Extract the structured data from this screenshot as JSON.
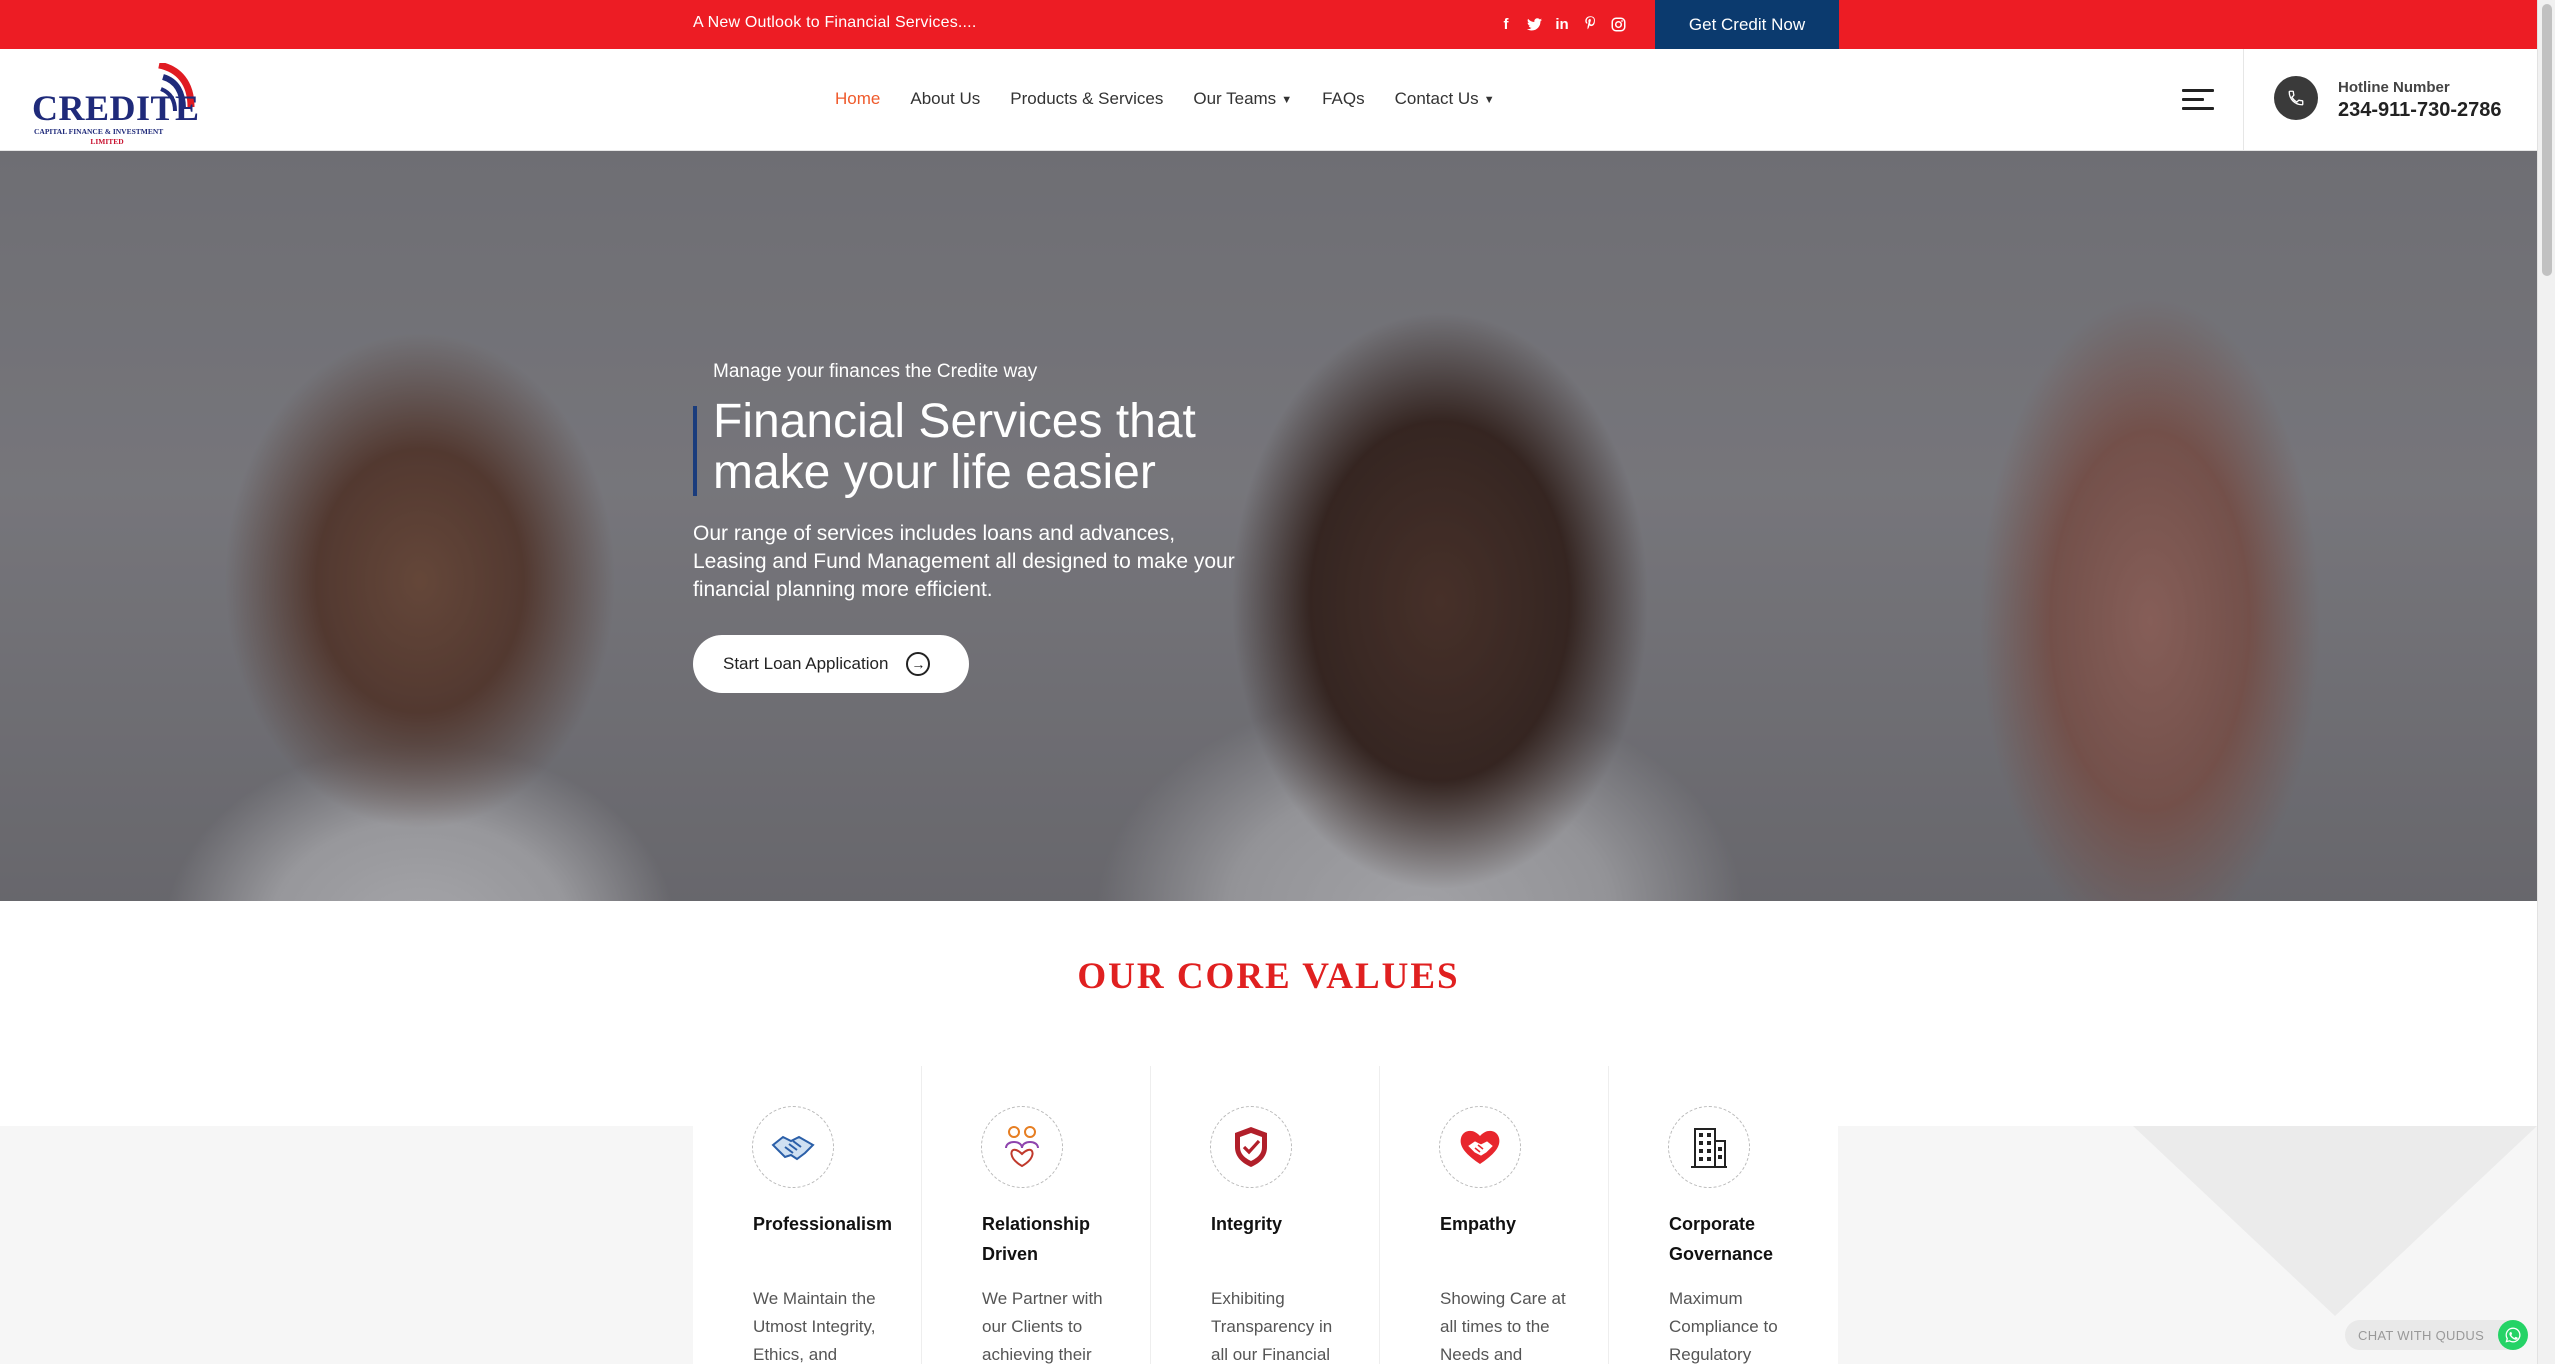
{
  "topbar": {
    "tagline": "A New Outlook to Financial Services....",
    "social_icons": [
      "facebook-icon",
      "twitter-icon",
      "linkedin-icon",
      "pinterest-icon",
      "instagram-icon"
    ],
    "cta_label": "Get Credit Now",
    "bg_color": "#ed1c24",
    "cta_color": "#0b3a6e"
  },
  "header": {
    "logo": {
      "name": "CREDITE",
      "subtitle": "CAPITAL FINANCE & INVESTMENT",
      "subtitle2": "LIMITED"
    },
    "nav": [
      {
        "label": "Home",
        "active": true
      },
      {
        "label": "About Us"
      },
      {
        "label": "Products & Services"
      },
      {
        "label": "Our Teams",
        "has_dropdown": true
      },
      {
        "label": "FAQs"
      },
      {
        "label": "Contact Us",
        "has_dropdown": true
      }
    ],
    "hotline_label": "Hotline Number",
    "hotline_number": "234-911-730-2786",
    "accent_color": "#ef5a2b"
  },
  "hero": {
    "kicker": "Manage your finances the Credite way",
    "title": "Financial Services that make your life easier",
    "description": "Our range of services includes loans and advances, Leasing and Fund Management all designed to make your financial planning more efficient.",
    "button_label": "Start Loan Application"
  },
  "core_values": {
    "title": "OUR CORE VALUES",
    "items": [
      {
        "icon": "handshake-icon",
        "title": "Professionalism",
        "text": "We Maintain the Utmost Integrity, Ethics, and"
      },
      {
        "icon": "people-heart-icon",
        "title": "Relationship Driven",
        "text": "We Partner with our Clients to achieving their"
      },
      {
        "icon": "shield-check-icon",
        "title": "Integrity",
        "text": "Exhibiting Transparency in all our Financial"
      },
      {
        "icon": "heart-handshake-icon",
        "title": "Empathy",
        "text": "Showing Care at all times to the Needs and"
      },
      {
        "icon": "building-icon",
        "title": "Corporate Governance",
        "text": "Maximum Compliance to Regulatory"
      }
    ]
  },
  "chat": {
    "label": "CHAT WITH QUDUS"
  }
}
